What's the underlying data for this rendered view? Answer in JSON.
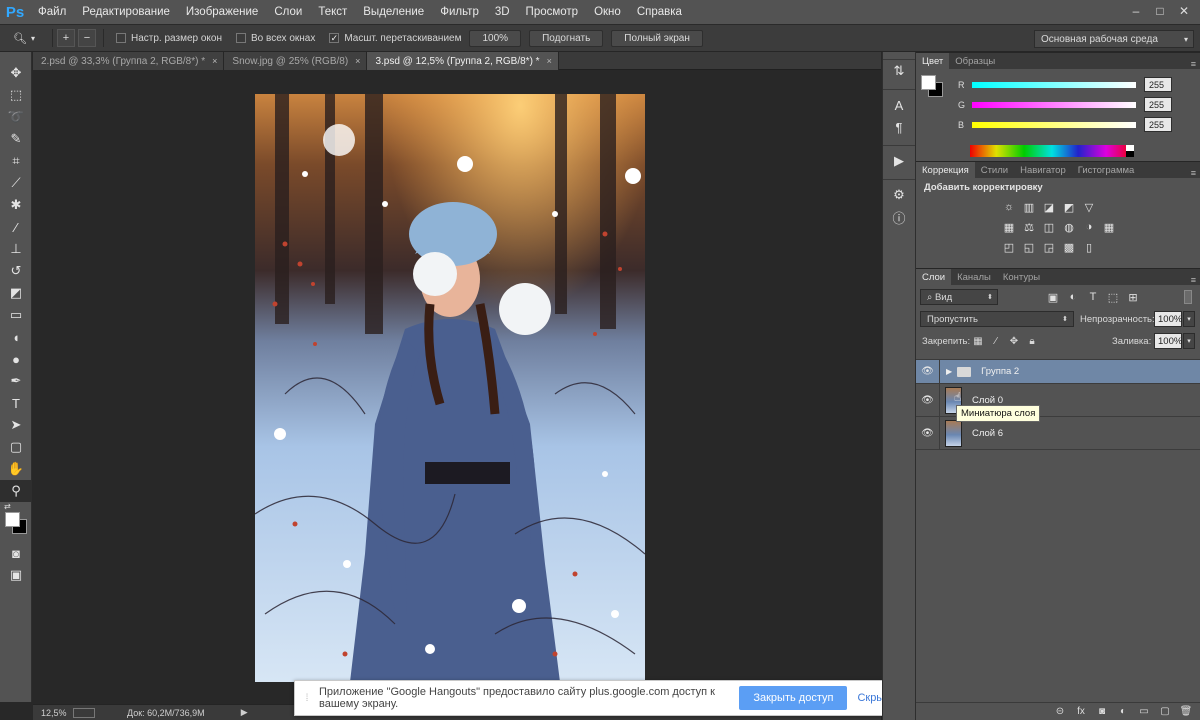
{
  "app": {
    "logo": "Ps",
    "menu": [
      "Файл",
      "Редактирование",
      "Изображение",
      "Слои",
      "Текст",
      "Выделение",
      "Фильтр",
      "3D",
      "Просмотр",
      "Окно",
      "Справка"
    ],
    "window_controls": [
      "–",
      "□",
      "✕"
    ]
  },
  "options": {
    "tool_icon": "zoom-icon",
    "tool_glyph": "🔍︎",
    "zoom_in": "+",
    "zoom_out": "−",
    "resize_windows": "Настр. размер окон",
    "all_windows": "Во всех окнах",
    "scrubby_zoom": "Масшт. перетаскиванием",
    "scrubby_checked": "✓",
    "btn_100": "100%",
    "btn_fit": "Подогнать",
    "btn_fullscreen": "Полный экран",
    "workspace": "Основная рабочая среда",
    "dropdown_arrow": "▾"
  },
  "tabs": [
    {
      "label": "2.psd @ 33,3% (Группа 2, RGB/8*) *",
      "close": "×"
    },
    {
      "label": "Snow.jpg @ 25% (RGB/8)",
      "close": "×"
    },
    {
      "label": "3.psd @ 12,5% (Группа 2, RGB/8*) *",
      "close": "×"
    }
  ],
  "tools": [
    {
      "name": "move-tool",
      "glyph": "✥"
    },
    {
      "name": "marquee-tool",
      "glyph": "⬚"
    },
    {
      "name": "lasso-tool",
      "glyph": "➰"
    },
    {
      "name": "quick-select-tool",
      "glyph": "✎"
    },
    {
      "name": "crop-tool",
      "glyph": "⌗"
    },
    {
      "name": "eyedropper-tool",
      "glyph": "⟋"
    },
    {
      "name": "healing-tool",
      "glyph": "✱"
    },
    {
      "name": "brush-tool",
      "glyph": "∕"
    },
    {
      "name": "stamp-tool",
      "glyph": "⊥"
    },
    {
      "name": "history-brush-tool",
      "glyph": "↺"
    },
    {
      "name": "eraser-tool",
      "glyph": "◩"
    },
    {
      "name": "gradient-tool",
      "glyph": "▭"
    },
    {
      "name": "blur-tool",
      "glyph": "◖"
    },
    {
      "name": "dodge-tool",
      "glyph": "●"
    },
    {
      "name": "pen-tool",
      "glyph": "✒"
    },
    {
      "name": "type-tool",
      "glyph": "T"
    },
    {
      "name": "path-select-tool",
      "glyph": "➤"
    },
    {
      "name": "shape-tool",
      "glyph": "▢"
    },
    {
      "name": "hand-tool",
      "glyph": "✋"
    },
    {
      "name": "zoom-tool",
      "glyph": "⚲"
    }
  ],
  "toolbar_extra": {
    "quick_mask": "◙",
    "screen_mode": "▣",
    "swap": "⇄"
  },
  "status": {
    "zoom": "12,5%",
    "doc": "Док: 60,2M/736,9M",
    "arrow": "▶"
  },
  "notification": {
    "grip": "⁞",
    "message": "Приложение \"Google Hangouts\" предоставило сайту plus.google.com доступ к вашему экрану.",
    "primary": "Закрыть доступ",
    "secondary": "Скрыть"
  },
  "icon_strip": [
    {
      "name": "history-icon",
      "glyph": "⇅"
    },
    {
      "name": "character-icon",
      "glyph": "A"
    },
    {
      "name": "paragraph-icon",
      "glyph": "¶"
    },
    {
      "name": "actions-play-icon",
      "glyph": "▶"
    },
    {
      "name": "clone-source-icon",
      "glyph": "⚙"
    },
    {
      "name": "info-icon",
      "glyph": "ⓘ"
    }
  ],
  "color_panel": {
    "tabs": [
      "Цвет",
      "Образцы"
    ],
    "menu": "≡",
    "channels": [
      {
        "label": "R",
        "value": "255",
        "gradient": "linear-gradient(to right,#00ffff,#ffffff)"
      },
      {
        "label": "G",
        "value": "255",
        "gradient": "linear-gradient(to right,#ff00ff,#ffffff)"
      },
      {
        "label": "B",
        "value": "255",
        "gradient": "linear-gradient(to right,#ffff00,#ffffff)"
      }
    ]
  },
  "adjust_panel": {
    "tabs": [
      "Коррекция",
      "Стили",
      "Навигатор",
      "Гистограмма"
    ],
    "title": "Добавить корректировку",
    "menu": "≡",
    "rows": [
      [
        "☼",
        "▥",
        "◪",
        "◩",
        "▽"
      ],
      [
        "▦",
        "⚖",
        "◫",
        "◍",
        "◑",
        "▦"
      ],
      [
        "◰",
        "◱",
        "◲",
        "▩",
        "▯"
      ]
    ]
  },
  "layers_panel": {
    "tabs": [
      "Слои",
      "Каналы",
      "Контуры"
    ],
    "menu": "≡",
    "filter": "⌕ Вид",
    "filter_icons": [
      "▣",
      "◐",
      "T",
      "⬚",
      "⊞"
    ],
    "blend_mode": "Пропустить",
    "opacity_label": "Непрозрачность:",
    "opacity": "100%",
    "lock_label": "Закрепить:",
    "lock_icons": [
      "▦",
      "∕",
      "✥",
      "🔒︎"
    ],
    "fill_label": "Заливка:",
    "fill": "100%",
    "eye": "👁︎",
    "layers": [
      {
        "name": "Группа 2",
        "type": "group",
        "expand": "▶"
      },
      {
        "name": "Слой 0",
        "type": "layer"
      },
      {
        "name": "Слой 6",
        "type": "layer"
      }
    ],
    "tooltip": "Миниатюра слоя",
    "hover_cursor": "☝",
    "bottom_icons": [
      "⊝",
      "fx",
      "◙",
      "◐",
      "▭",
      "▢",
      "🗑︎"
    ]
  }
}
